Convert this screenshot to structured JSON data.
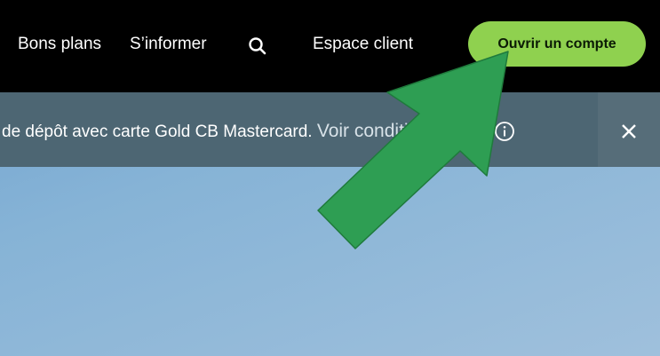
{
  "nav": {
    "bons_plans": "Bons plans",
    "sinformer": "S’informer",
    "search_icon": "search-icon",
    "espace_client": "Espace client",
    "cta_label": "Ouvrir un compte"
  },
  "banner": {
    "text": "de dépôt avec carte Gold CB Mastercard.",
    "link": "Voir conditions",
    "info_icon": "info-icon",
    "close_icon": "close-icon"
  },
  "colors": {
    "nav_bg": "#000000",
    "cta_bg": "#8fd14f",
    "banner_bg": "#4d6673",
    "arrow": "#2e9e53",
    "hero_sky": "#86b3d6"
  }
}
